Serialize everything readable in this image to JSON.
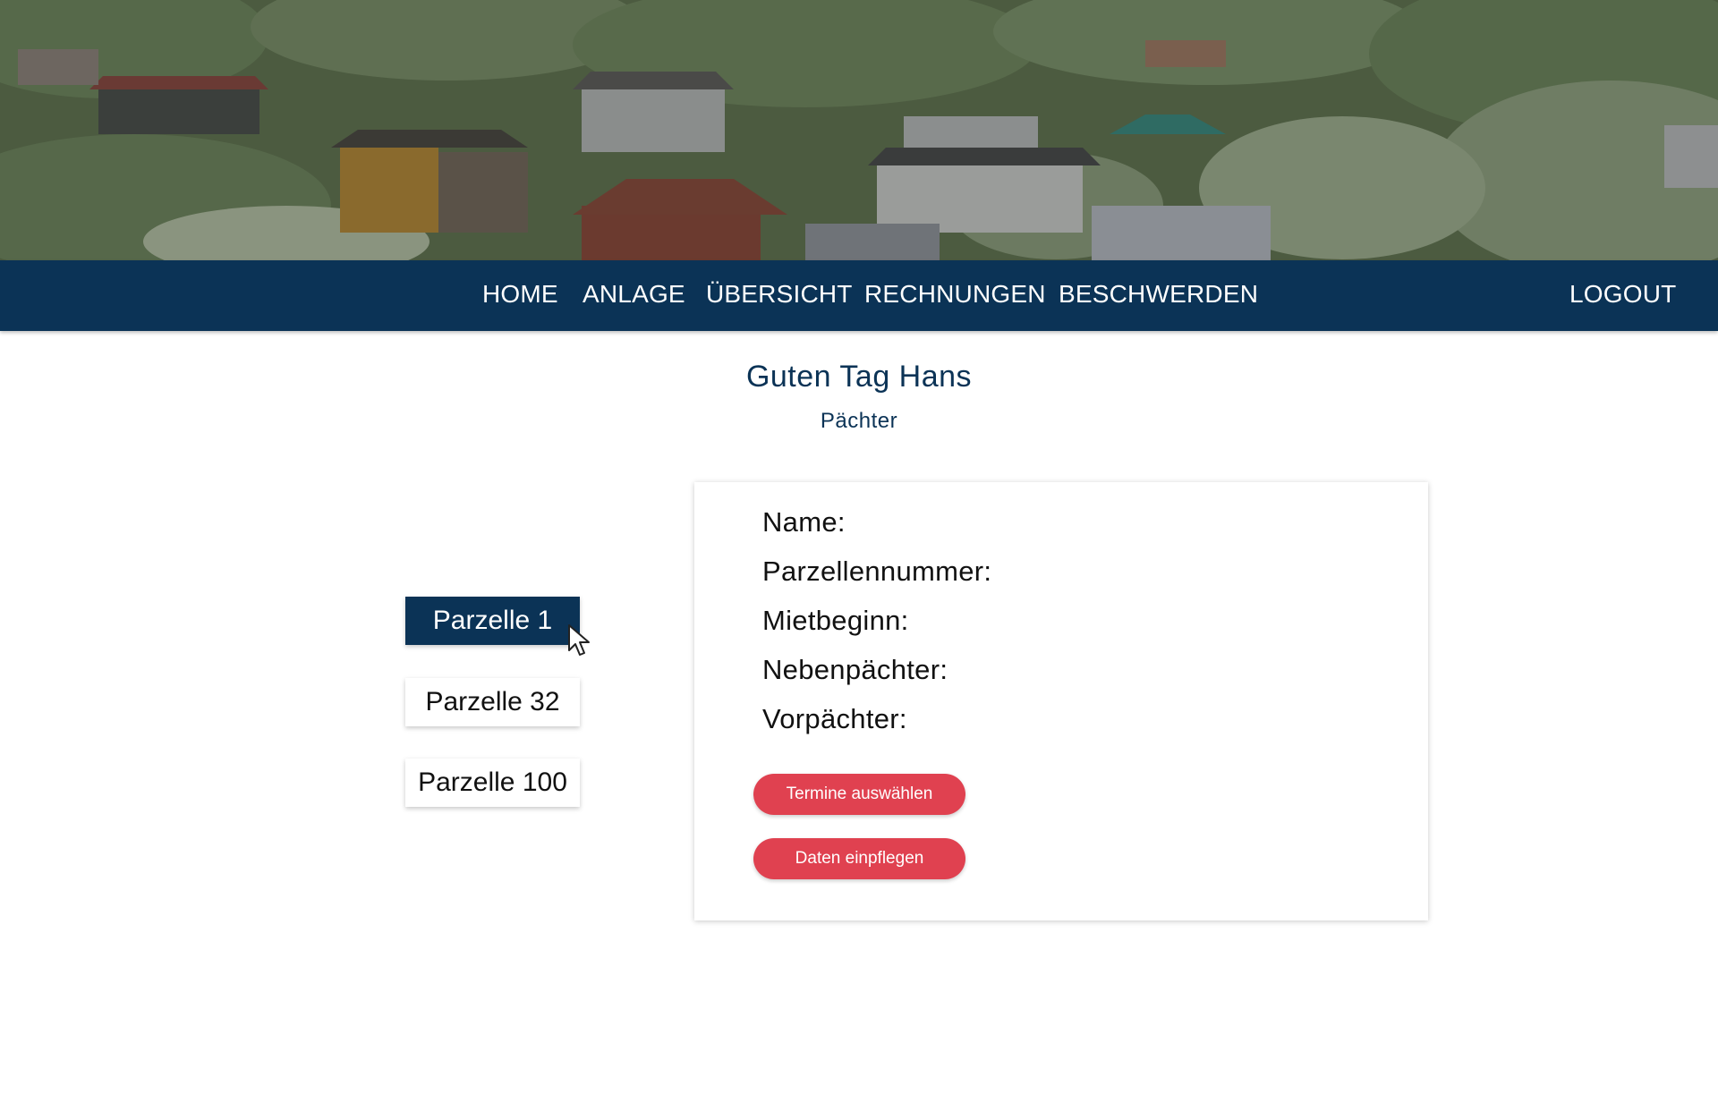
{
  "nav": {
    "items": [
      {
        "label": "HOME"
      },
      {
        "label": "ANLAGE"
      },
      {
        "label": "ÜBERSICHT"
      },
      {
        "label": "RECHNUNGEN"
      },
      {
        "label": "BESCHWERDEN"
      }
    ],
    "logout": "LOGOUT"
  },
  "greeting": {
    "title": "Guten Tag Hans",
    "role": "Pächter"
  },
  "parcels": {
    "items": [
      {
        "label": "Parzelle 1",
        "active": true
      },
      {
        "label": "Parzelle 32",
        "active": false
      },
      {
        "label": "Parzelle 100",
        "active": false
      }
    ]
  },
  "details": {
    "fields": [
      {
        "label": "Name:"
      },
      {
        "label": "Parzellennummer:"
      },
      {
        "label": "Mietbeginn:"
      },
      {
        "label": "Nebenpächter:"
      },
      {
        "label": "Vorpächter:"
      }
    ],
    "buttons": {
      "appointments": "Termine auswählen",
      "enter_data": "Daten einpflegen"
    }
  },
  "colors": {
    "primary": "#0b3356",
    "accent": "#e04150",
    "background": "#ffffff"
  },
  "icons": {
    "cursor": "mouse-pointer-icon"
  }
}
